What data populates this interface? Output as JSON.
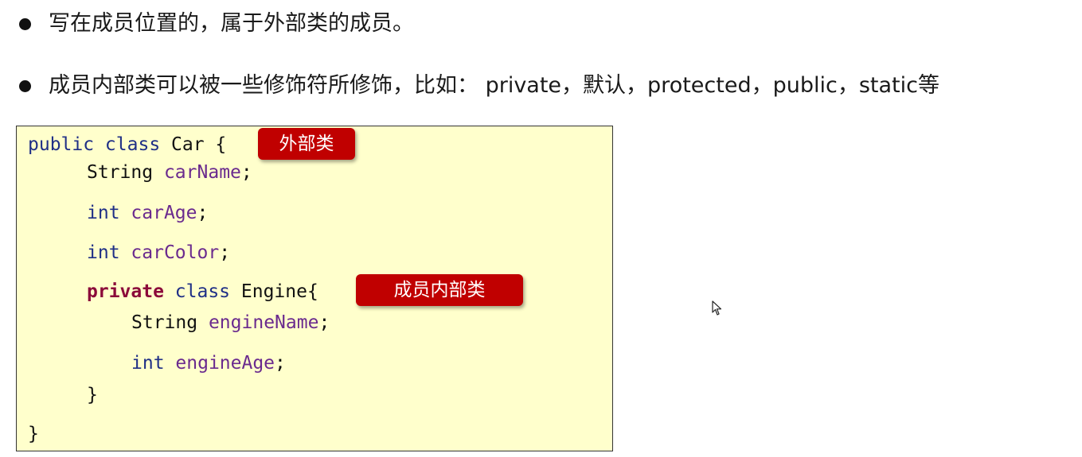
{
  "bullets": [
    "写在成员位置的，属于外部类的成员。",
    "成员内部类可以被一些修饰符所修饰，比如： private，默认，protected，public，static等"
  ],
  "code": {
    "l1_kw": "public class",
    "l1_rest": " Car {",
    "l2_type": "String",
    "l2_var": "carName",
    "l3_type": "int",
    "l3_var": "carAge",
    "l4_type": "int",
    "l4_var": "carColor",
    "l5_mod": "private",
    "l5_kw": "class",
    "l5_rest": " Engine{",
    "l6_type": "String",
    "l6_var": "engineName",
    "l7_type": "int",
    "l7_var": "engineAge",
    "l8": "}",
    "l9": "}",
    "semicolon": ";"
  },
  "tags": {
    "outer": "外部类",
    "member_inner": "成员内部类"
  },
  "icons": {
    "cursor": "mouse-pointer-icon"
  },
  "colors": {
    "code_background": "#ffffcc",
    "tag_red": "#c00000",
    "keyword": "#1f2f86",
    "private_keyword": "#8b0a3a",
    "variable": "#6a2a8e"
  }
}
